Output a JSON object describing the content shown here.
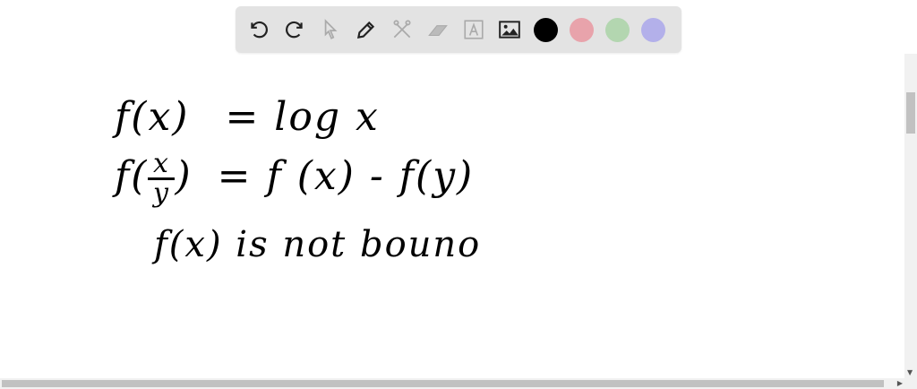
{
  "toolbar": {
    "tools": [
      "undo-icon",
      "redo-icon",
      "select-icon",
      "pen-icon",
      "tools-icon",
      "eraser-icon",
      "text-icon",
      "image-icon"
    ],
    "colors": [
      "#000000",
      "#e8a3ab",
      "#b3d6b0",
      "#b3b0ea"
    ]
  },
  "canvas": {
    "line1": {
      "lhs": "f(x)",
      "rhs": "= log x"
    },
    "line2": {
      "f": "f",
      "num": "x",
      "den": "y",
      "rhs": "= f (x) - f(y)"
    },
    "line3": "f(x) is not bouno"
  }
}
